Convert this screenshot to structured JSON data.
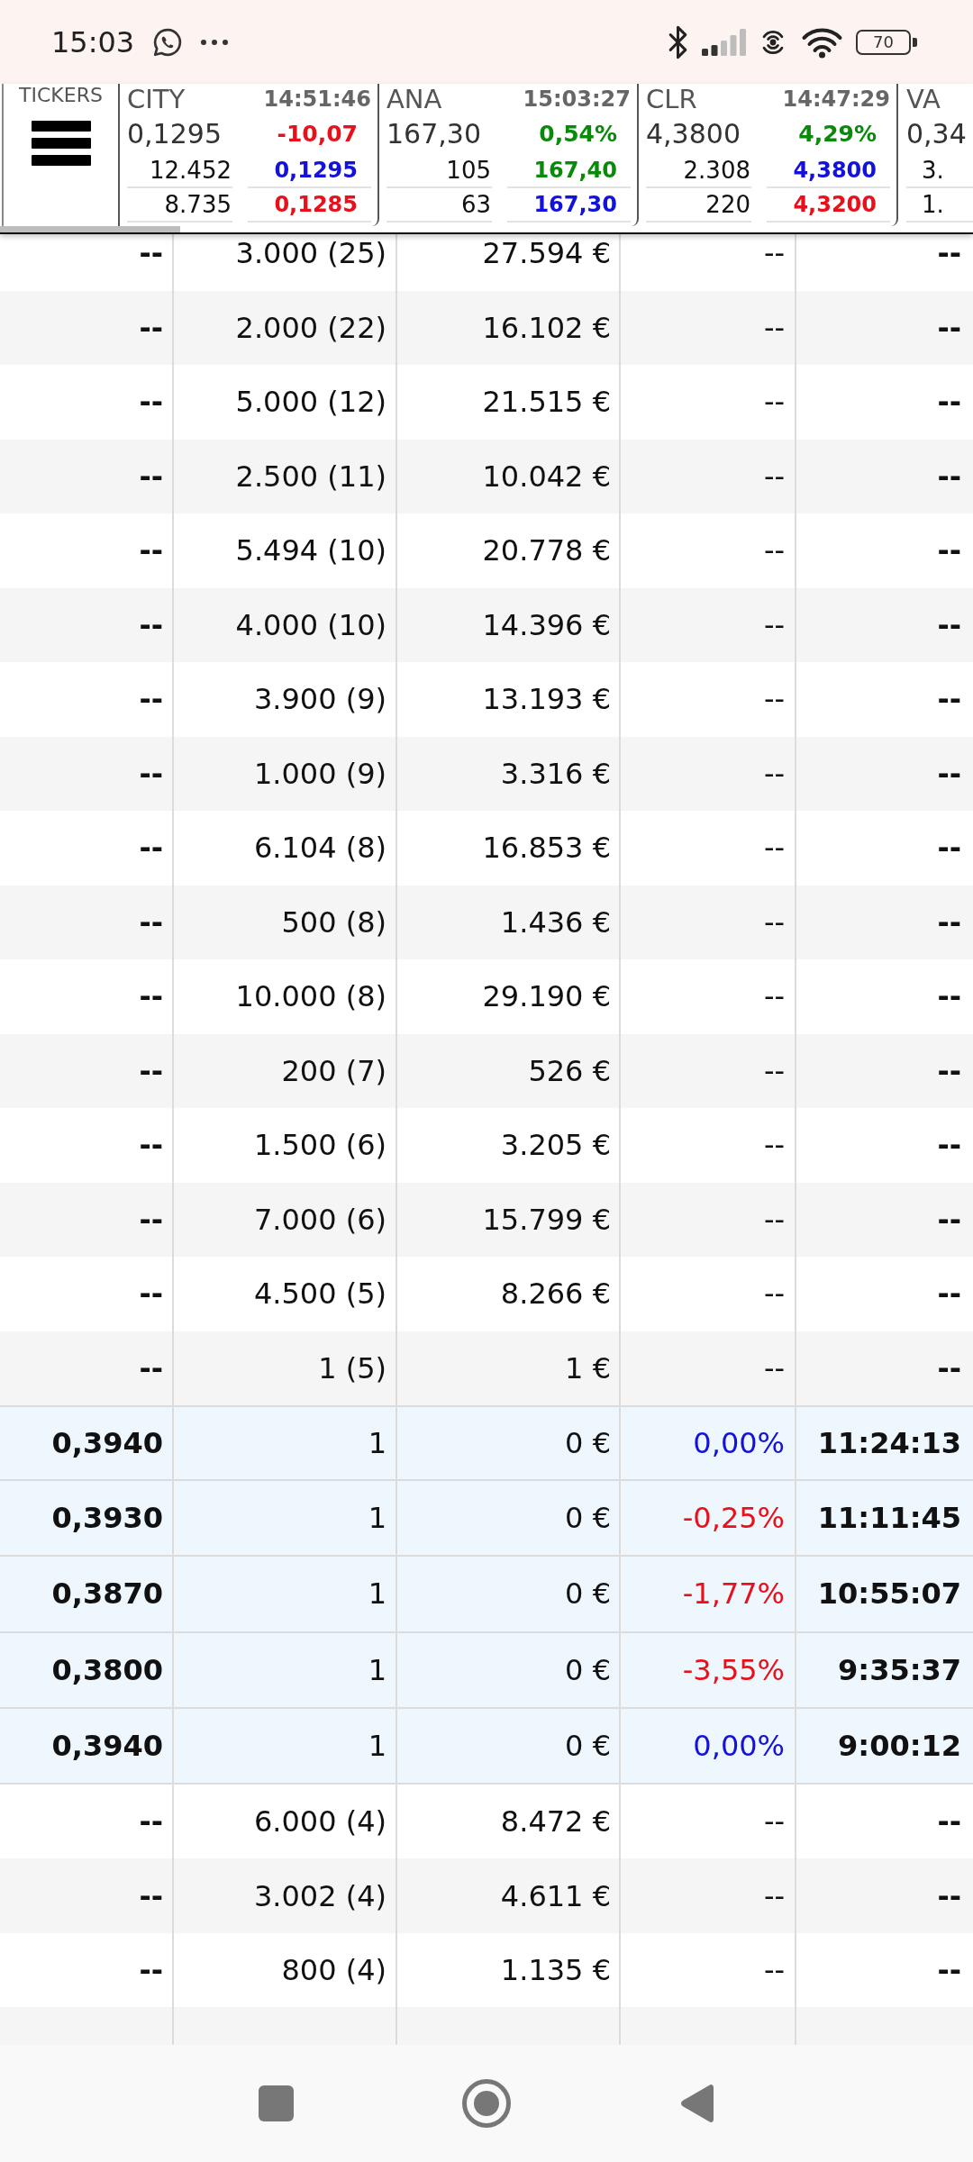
{
  "status_bar": {
    "time": "15:03",
    "battery": "70"
  },
  "ticker_bar": {
    "label": "TICKERS",
    "tickers": [
      {
        "kind": "full",
        "name": "CITY",
        "time": "14:51:46",
        "price": "0,1295",
        "change": {
          "text": "-10,07",
          "color": "#e8101a"
        },
        "book": [
          {
            "volume": "12.452",
            "price": "0,1295",
            "color": "#1212dc"
          },
          {
            "volume": "8.735",
            "price": "0,1285",
            "color": "#e8101a"
          }
        ]
      },
      {
        "kind": "full",
        "name": "ANA",
        "time": "15:03:27",
        "price": "167,30",
        "change": {
          "text": "0,54%",
          "color": "#0a8a0a"
        },
        "book": [
          {
            "volume": "105",
            "price": "167,40",
            "color": "#0a8a0a"
          },
          {
            "volume": "63",
            "price": "167,30",
            "color": "#1212dc"
          }
        ]
      },
      {
        "kind": "full",
        "name": "CLR",
        "time": "14:47:29",
        "price": "4,3800",
        "change": {
          "text": "4,29%",
          "color": "#0a8a0a"
        },
        "book": [
          {
            "volume": "2.308",
            "price": "4,3800",
            "color": "#1212dc"
          },
          {
            "volume": "220",
            "price": "4,3200",
            "color": "#e8101a"
          }
        ]
      },
      {
        "kind": "partial",
        "name": "VA",
        "price": "0,34",
        "book": [
          {
            "volume": "3."
          },
          {
            "volume": "1."
          }
        ]
      }
    ]
  },
  "table": {
    "rows": [
      {
        "kind": "level",
        "cells": [
          "--",
          "3.000 (25)",
          "27.594 €",
          "--",
          "--"
        ]
      },
      {
        "kind": "level",
        "cells": [
          "--",
          "2.000 (22)",
          "16.102 €",
          "--",
          "--"
        ]
      },
      {
        "kind": "level",
        "cells": [
          "--",
          "5.000 (12)",
          "21.515 €",
          "--",
          "--"
        ]
      },
      {
        "kind": "level",
        "cells": [
          "--",
          "2.500 (11)",
          "10.042 €",
          "--",
          "--"
        ]
      },
      {
        "kind": "level",
        "cells": [
          "--",
          "5.494 (10)",
          "20.778 €",
          "--",
          "--"
        ]
      },
      {
        "kind": "level",
        "cells": [
          "--",
          "4.000 (10)",
          "14.396 €",
          "--",
          "--"
        ]
      },
      {
        "kind": "level",
        "cells": [
          "--",
          "3.900 (9)",
          "13.193 €",
          "--",
          "--"
        ]
      },
      {
        "kind": "level",
        "cells": [
          "--",
          "1.000 (9)",
          "3.316 €",
          "--",
          "--"
        ]
      },
      {
        "kind": "level",
        "cells": [
          "--",
          "6.104 (8)",
          "16.853 €",
          "--",
          "--"
        ]
      },
      {
        "kind": "level",
        "cells": [
          "--",
          "500 (8)",
          "1.436 €",
          "--",
          "--"
        ]
      },
      {
        "kind": "level",
        "cells": [
          "--",
          "10.000 (8)",
          "29.190 €",
          "--",
          "--"
        ]
      },
      {
        "kind": "level",
        "cells": [
          "--",
          "200 (7)",
          "526 €",
          "--",
          "--"
        ]
      },
      {
        "kind": "level",
        "cells": [
          "--",
          "1.500 (6)",
          "3.205 €",
          "--",
          "--"
        ]
      },
      {
        "kind": "level",
        "cells": [
          "--",
          "7.000 (6)",
          "15.799 €",
          "--",
          "--"
        ]
      },
      {
        "kind": "level",
        "cells": [
          "--",
          "4.500 (5)",
          "8.266 €",
          "--",
          "--"
        ]
      },
      {
        "kind": "level",
        "cells": [
          "--",
          "1 (5)",
          "1 €",
          "--",
          "--"
        ]
      },
      {
        "kind": "trade",
        "color": "#1212dc",
        "cells": [
          "0,3940",
          "1",
          "0 €",
          "0,00%",
          "11:24:13"
        ]
      },
      {
        "kind": "trade",
        "color": "#e8101a",
        "cells": [
          "0,3930",
          "1",
          "0 €",
          "-0,25%",
          "11:11:45"
        ]
      },
      {
        "kind": "trade",
        "color": "#e8101a",
        "cells": [
          "0,3870",
          "1",
          "0 €",
          "-1,77%",
          "10:55:07"
        ]
      },
      {
        "kind": "trade",
        "color": "#e8101a",
        "cells": [
          "0,3800",
          "1",
          "0 €",
          "-3,55%",
          "9:35:37"
        ]
      },
      {
        "kind": "trade",
        "color": "#1212dc",
        "cells": [
          "0,3940",
          "1",
          "0 €",
          "0,00%",
          "9:00:12"
        ]
      },
      {
        "kind": "level",
        "cells": [
          "--",
          "6.000 (4)",
          "8.472 €",
          "--",
          "--"
        ]
      },
      {
        "kind": "level",
        "cells": [
          "--",
          "3.002 (4)",
          "4.611 €",
          "--",
          "--"
        ]
      },
      {
        "kind": "level",
        "cells": [
          "--",
          "800 (4)",
          "1.135 €",
          "--",
          "--"
        ]
      }
    ]
  }
}
